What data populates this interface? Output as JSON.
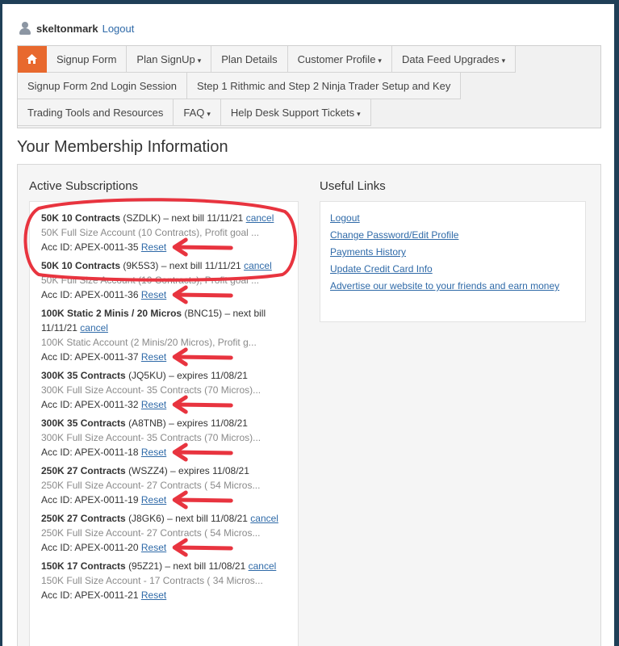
{
  "header": {
    "username": "skeltonmark",
    "logout": "Logout"
  },
  "nav": {
    "home_icon": "home-icon",
    "row1": [
      {
        "label": "Signup Form",
        "dropdown": false
      },
      {
        "label": "Plan SignUp",
        "dropdown": true
      },
      {
        "label": "Plan Details",
        "dropdown": false
      },
      {
        "label": "Customer Profile",
        "dropdown": true
      },
      {
        "label": "Data Feed Upgrades",
        "dropdown": true
      }
    ],
    "row2": [
      {
        "label": "Signup Form 2nd Login Session",
        "dropdown": false
      },
      {
        "label": "Step 1 Rithmic and Step 2 Ninja Trader Setup and Key",
        "dropdown": false
      }
    ],
    "row3": [
      {
        "label": "Trading Tools and Resources",
        "dropdown": false
      },
      {
        "label": "FAQ",
        "dropdown": true
      },
      {
        "label": "Help Desk Support Tickets",
        "dropdown": true
      }
    ]
  },
  "page_title": "Your Membership Information",
  "subscriptions": {
    "title": "Active Subscriptions",
    "items": [
      {
        "name": "50K 10 Contracts",
        "code": "(SZDLK)",
        "status": " – next bill 11/11/21",
        "cancel": "cancel",
        "desc": "50K Full Size Account (10 Contracts), Profit goal ...",
        "acc_label": "Acc ID: APEX-0011-35",
        "reset": "Reset"
      },
      {
        "name": "50K 10 Contracts",
        "code": "(9K5S3)",
        "status": " – next bill 11/11/21",
        "cancel": "cancel",
        "desc": "50K Full Size Account (10 Contracts), Profit goal ...",
        "acc_label": "Acc ID: APEX-0011-36",
        "reset": "Reset"
      },
      {
        "name": "100K Static 2 Minis / 20 Micros",
        "code": "(BNC15)",
        "status": " – next bill 11/11/21",
        "cancel": "cancel",
        "desc": "100K Static Account (2 Minis/20 Micros), Profit g...",
        "acc_label": "Acc ID: APEX-0011-37",
        "reset": "Reset"
      },
      {
        "name": "300K 35 Contracts",
        "code": "(JQ5KU)",
        "status": " – expires 11/08/21",
        "cancel": "",
        "desc": "300K Full Size Account- 35 Contracts (70 Micros)...",
        "acc_label": "Acc ID: APEX-0011-32",
        "reset": "Reset"
      },
      {
        "name": "300K 35 Contracts",
        "code": "(A8TNB)",
        "status": " – expires 11/08/21",
        "cancel": "",
        "desc": "300K Full Size Account- 35 Contracts (70 Micros)...",
        "acc_label": "Acc ID: APEX-0011-18",
        "reset": "Reset"
      },
      {
        "name": "250K 27 Contracts",
        "code": "(WSZZ4)",
        "status": " – expires 11/08/21",
        "cancel": "",
        "desc": "250K Full Size Account- 27 Contracts ( 54 Micros...",
        "acc_label": "Acc ID: APEX-0011-19",
        "reset": "Reset"
      },
      {
        "name": "250K 27 Contracts",
        "code": "(J8GK6)",
        "status": " – next bill 11/08/21",
        "cancel": "cancel",
        "desc": "250K Full Size Account- 27 Contracts ( 54 Micros...",
        "acc_label": "Acc ID: APEX-0011-20",
        "reset": "Reset"
      },
      {
        "name": "150K 17 Contracts",
        "code": "(95Z21)",
        "status": " – next bill 11/08/21",
        "cancel": "cancel",
        "desc": "150K Full Size Account - 17 Contracts ( 34 Micros...",
        "acc_label": "Acc ID: APEX-0011-21",
        "reset": "Reset"
      }
    ]
  },
  "useful_links": {
    "title": "Useful Links",
    "links": [
      "Logout",
      "Change Password/Edit Profile",
      "Payments History",
      "Update Credit Card Info",
      "Advertise our website to your friends and earn money"
    ]
  },
  "colors": {
    "brand_orange": "#e8692e",
    "link": "#2f6aa8",
    "annotation_red": "#e8343f"
  }
}
